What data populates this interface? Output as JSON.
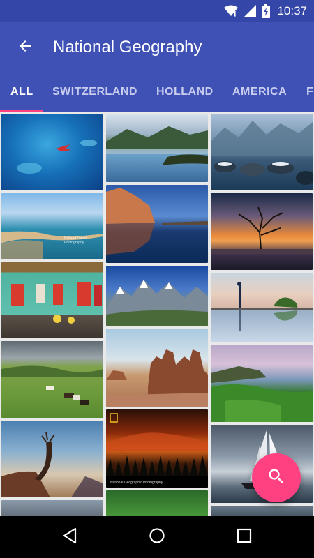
{
  "status_bar": {
    "time": "10:37",
    "icons": [
      "wifi-icon",
      "signal-icon",
      "battery-charging-icon"
    ]
  },
  "app_bar": {
    "title": "National Geography",
    "back_icon": "arrow-back-icon"
  },
  "tabs": [
    {
      "label": "ALL",
      "active": true
    },
    {
      "label": "SWITZERLAND",
      "active": false
    },
    {
      "label": "HOLLAND",
      "active": false
    },
    {
      "label": "AMERICA",
      "active": false
    },
    {
      "label": "FR",
      "active": false
    }
  ],
  "photos": [
    {
      "name": "ocean-plane-photo",
      "column": 1,
      "caption": ""
    },
    {
      "name": "coastline-photo",
      "column": 1,
      "caption": "Holland Travel Photography"
    },
    {
      "name": "colorful-houses-photo",
      "column": 1,
      "caption": ""
    },
    {
      "name": "grassland-cattle-photo",
      "column": 1,
      "caption": ""
    },
    {
      "name": "lone-tree-photo",
      "column": 1,
      "caption": ""
    },
    {
      "name": "city-photo",
      "column": 1,
      "caption": ""
    },
    {
      "name": "mountain-lake-photo",
      "column": 2,
      "caption": ""
    },
    {
      "name": "red-rocks-lake-photo",
      "column": 2,
      "caption": ""
    },
    {
      "name": "alpine-peaks-photo",
      "column": 2,
      "caption": ""
    },
    {
      "name": "desert-ruins-photo",
      "column": 2,
      "caption": ""
    },
    {
      "name": "volcano-forest-photo",
      "column": 2,
      "caption": "National Geographic Photography"
    },
    {
      "name": "green-forest-photo",
      "column": 2,
      "caption": ""
    },
    {
      "name": "misty-lake-photo",
      "column": 3,
      "caption": ""
    },
    {
      "name": "sunset-tree-photo",
      "column": 3,
      "caption": ""
    },
    {
      "name": "reflection-figure-photo",
      "column": 3,
      "caption": ""
    },
    {
      "name": "mossy-coast-photo",
      "column": 3,
      "caption": ""
    },
    {
      "name": "sailboat-photo",
      "column": 3,
      "caption": ""
    },
    {
      "name": "bottom-photo",
      "column": 3,
      "caption": ""
    }
  ],
  "fab": {
    "icon": "search-icon",
    "color": "#ff4081"
  },
  "nav_bar": {
    "icons": [
      "back-triangle-icon",
      "home-circle-icon",
      "recents-square-icon"
    ]
  },
  "colors": {
    "primary": "#3f51b5",
    "primary_dark": "#3446a8",
    "accent": "#ff4081"
  }
}
